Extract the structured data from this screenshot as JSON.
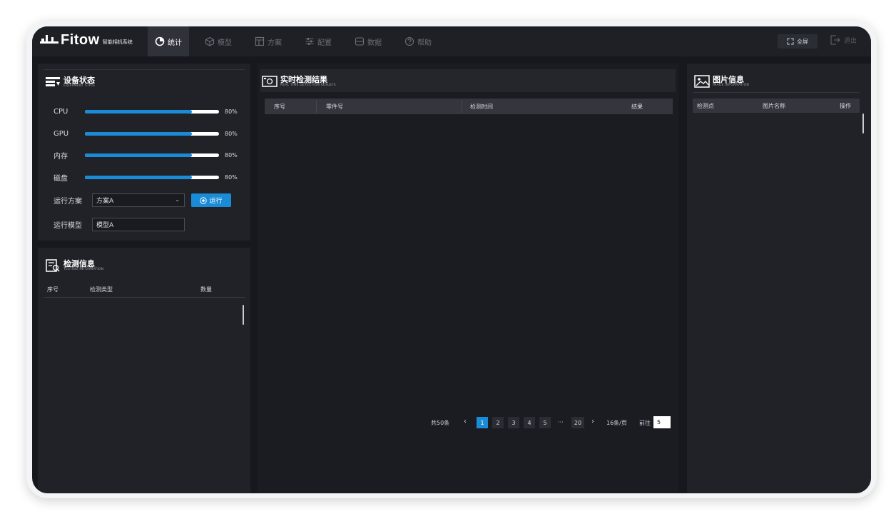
{
  "app": {
    "logo_text": "Fitow",
    "logo_subtitle": "智能相机系统"
  },
  "nav": [
    {
      "label": "统计",
      "icon": "pie-chart-icon",
      "active": true
    },
    {
      "label": "模型",
      "icon": "cube-icon"
    },
    {
      "label": "方案",
      "icon": "layout-icon"
    },
    {
      "label": "配置",
      "icon": "sliders-icon"
    },
    {
      "label": "数据",
      "icon": "database-icon"
    },
    {
      "label": "帮助",
      "icon": "help-circle-icon"
    }
  ],
  "header": {
    "fullscreen_label": "全屏",
    "logout_label": "退出"
  },
  "equipment": {
    "title": "设备状态",
    "subtitle": "EQUIPMENT STATE",
    "stats": [
      {
        "label": "CPU",
        "value": "80%",
        "fraction": 0.8
      },
      {
        "label": "GPU",
        "value": "80%",
        "fraction": 0.8
      },
      {
        "label": "内存",
        "value": "80%",
        "fraction": 0.8
      },
      {
        "label": "磁盘",
        "value": "80%",
        "fraction": 0.8
      }
    ],
    "scheme_label": "运行方案",
    "scheme_value": "方案A",
    "run_label": "运行",
    "model_label": "运行模型",
    "model_value": "模型A"
  },
  "testing": {
    "title": "检测信息",
    "subtitle": "TESTING INFORMATION",
    "columns": [
      "序号",
      "检测类型",
      "数量"
    ]
  },
  "realtime": {
    "title": "实时检测结果",
    "subtitle": "REAL TIME DETECTION RESULTS",
    "columns": [
      "序号",
      "零件号",
      "检测时间",
      "结果"
    ]
  },
  "image_info": {
    "title": "图片信息",
    "subtitle": "IMAGE INFORMATION",
    "columns": [
      "检测点",
      "图片名称",
      "操作"
    ]
  },
  "pagination": {
    "total": "共50条",
    "prev": "‹",
    "pages": [
      "1",
      "2",
      "3",
      "4",
      "5"
    ],
    "ellipsis": "···",
    "last": "20",
    "next": "›",
    "per_page": "16条/页",
    "goto_label": "前往",
    "goto_value": "5",
    "active_page": "1"
  },
  "colors": {
    "accent": "#1a8bd6",
    "background": "#17181d",
    "panel": "#212227",
    "topbar": "#1f2026"
  }
}
